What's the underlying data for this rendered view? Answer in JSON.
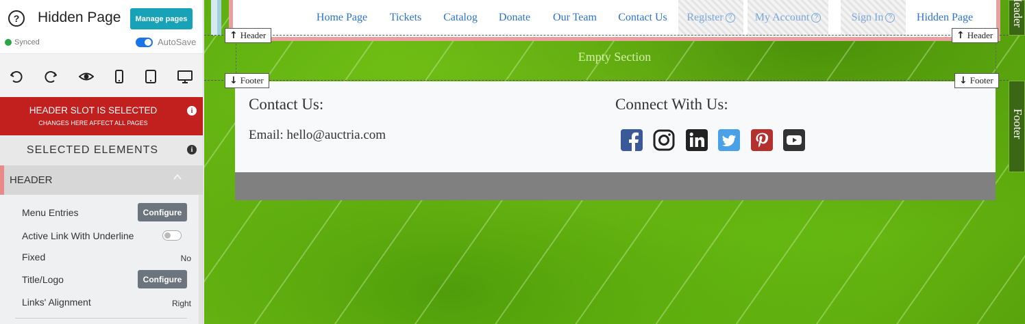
{
  "sidebar": {
    "page_title": "Hidden Page",
    "manage_pages_label": "Manage pages",
    "synced_label": "Synced",
    "autosave_label": "AutoSave",
    "autosave_on": true,
    "toolbar": [
      "undo-icon",
      "redo-icon",
      "preview-eye-icon",
      "mobile-icon",
      "tablet-icon",
      "desktop-icon"
    ],
    "warning": {
      "title": "HEADER SLOT IS SELECTED",
      "subtitle": "CHANGES HERE AFFECT ALL PAGES"
    },
    "selected_elements_label": "SELECTED ELEMENTS",
    "section_label": "HEADER",
    "properties": {
      "menu_entries": {
        "label": "Menu Entries",
        "button": "Configure"
      },
      "active_link_underline": {
        "label": "Active Link With Underline",
        "enabled": false
      },
      "fixed": {
        "label": "Fixed",
        "value": "No"
      },
      "title_logo": {
        "label": "Title/Logo",
        "button": "Configure"
      },
      "links_alignment": {
        "label": "Links' Alignment",
        "value": "Right"
      }
    }
  },
  "canvas": {
    "nav": [
      {
        "label": "Home Page"
      },
      {
        "label": "Tickets"
      },
      {
        "label": "Catalog"
      },
      {
        "label": "Donate"
      },
      {
        "label": "Our Team"
      },
      {
        "label": "Contact Us"
      },
      {
        "label": "Register",
        "hidden": true
      },
      {
        "label": "My Account",
        "hidden": true
      },
      {
        "label": "Sign In",
        "hidden": true
      },
      {
        "label": "Hidden Page"
      }
    ],
    "header_tag": "Header",
    "footer_tag": "Footer",
    "empty_section": "Empty Section",
    "footer": {
      "contact_title": "Contact Us:",
      "email_text": "Email: hello@auctria.com",
      "connect_title": "Connect With Us:",
      "social": [
        {
          "icon": "facebook-icon",
          "color": "#3b5998"
        },
        {
          "icon": "instagram-icon",
          "color": "#222222"
        },
        {
          "icon": "linkedin-icon",
          "color": "#222222"
        },
        {
          "icon": "twitter-icon",
          "color": "#4aa1e8"
        },
        {
          "icon": "pinterest-icon",
          "color": "#b5312f"
        },
        {
          "icon": "youtube-icon",
          "color": "#333333"
        }
      ]
    },
    "side_tabs": {
      "header": "Header",
      "footer": "Footer"
    }
  },
  "colors": {
    "accent": "#17a2b8",
    "warning_bg": "#c1201f",
    "header_border": "#e8a0a0",
    "nav_link": "#2a73c8"
  }
}
